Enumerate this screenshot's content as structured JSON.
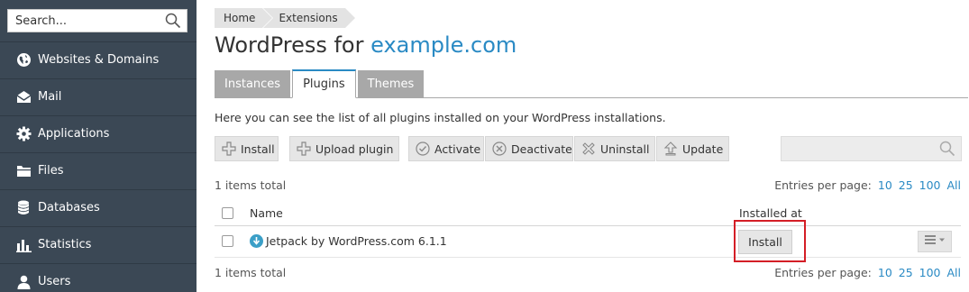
{
  "sidebar": {
    "search": {
      "placeholder": "Search..."
    },
    "items": [
      {
        "label": "Websites & Domains",
        "icon": "globe-icon"
      },
      {
        "label": "Mail",
        "icon": "envelope-icon"
      },
      {
        "label": "Applications",
        "icon": "gear-icon"
      },
      {
        "label": "Files",
        "icon": "folder-icon"
      },
      {
        "label": "Databases",
        "icon": "database-icon"
      },
      {
        "label": "Statistics",
        "icon": "bar-chart-icon"
      },
      {
        "label": "Users",
        "icon": "user-icon"
      }
    ]
  },
  "breadcrumb": [
    "Home",
    "Extensions"
  ],
  "page": {
    "title_prefix": "WordPress for",
    "title_domain": "example.com",
    "description": "Here you can see the list of all plugins installed on your WordPress installations."
  },
  "tabs": [
    {
      "label": "Instances",
      "active": false
    },
    {
      "label": "Plugins",
      "active": true
    },
    {
      "label": "Themes",
      "active": false
    }
  ],
  "toolbar": {
    "install": "Install",
    "upload": "Upload plugin",
    "activate": "Activate",
    "deactivate": "Deactivate",
    "uninstall": "Uninstall",
    "update": "Update",
    "search_placeholder": ""
  },
  "list": {
    "total_top": "1 items total",
    "total_bottom": "1 items total",
    "entries_label": "Entries per page:",
    "entries_options": [
      "10",
      "25",
      "100",
      "All"
    ],
    "columns": {
      "name": "Name",
      "installed_at": "Installed at"
    },
    "rows": [
      {
        "name": "Jetpack by WordPress.com 6.1.1",
        "installed_action": "Install"
      }
    ]
  },
  "colors": {
    "sidebar_bg": "#3b4855",
    "accent": "#2a8ac4",
    "highlight": "#d41e26"
  }
}
